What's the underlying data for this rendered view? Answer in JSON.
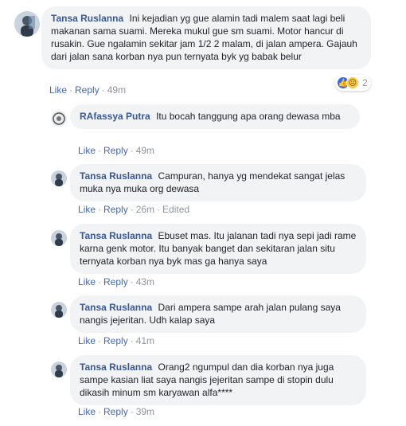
{
  "main_comment": {
    "name": "Tansa Ruslanna",
    "text": "Ini kejadian yg gue alamin tadi malem saat lagi beli makanan sama suami. Mereka mukul gue sm suami. Motor hancur di rusakin. Gue ngalamin sekitar jam 1/2 2 malam, di jalan ampera. Gajauh dari jalan sana korban nya pun ternyata byk yg babak belur",
    "actions": {
      "like": "Like",
      "reply": "Reply",
      "time": "49m"
    },
    "reactions": {
      "count": "2",
      "icons": [
        "like-icon",
        "sad-icon"
      ]
    }
  },
  "replies": [
    {
      "name": "RAfassya Putra",
      "text": "Itu bocah tanggung apa orang dewasa mba",
      "actions": {
        "like": "Like",
        "reply": "Reply",
        "time": "49m",
        "edited": ""
      }
    },
    {
      "name": "Tansa Ruslanna",
      "text": "Campuran, hanya yg mendekat sangat jelas muka nya muka org dewasa",
      "actions": {
        "like": "Like",
        "reply": "Reply",
        "time": "26m",
        "edited": "Edited"
      }
    },
    {
      "name": "Tansa Ruslanna",
      "text": "Ebuset mas. Itu jalanan tadi nya sepi jadi rame karna genk motor. Itu banyak banget dan sekitaran jalan situ ternyata korban nya byk mas ga hanya saya",
      "actions": {
        "like": "Like",
        "reply": "Reply",
        "time": "43m",
        "edited": ""
      }
    },
    {
      "name": "Tansa Ruslanna",
      "text": "Dari ampera sampe arah jalan pulang saya nangis jejeritan. Udh kalap saya",
      "actions": {
        "like": "Like",
        "reply": "Reply",
        "time": "41m",
        "edited": ""
      }
    },
    {
      "name": "Tansa Ruslanna",
      "text": "Orang2 ngumpul dan dia korban nya juga sampe kasian liat saya nangis jejeritan sampe di stopin dulu dikasih minum sm karyawan alfa****",
      "actions": {
        "like": "Like",
        "reply": "Reply",
        "time": "39m",
        "edited": ""
      }
    }
  ],
  "colors": {
    "name": "#385898",
    "link": "#4267b2",
    "meta": "#90949c",
    "bubble": "#f2f3f5"
  }
}
